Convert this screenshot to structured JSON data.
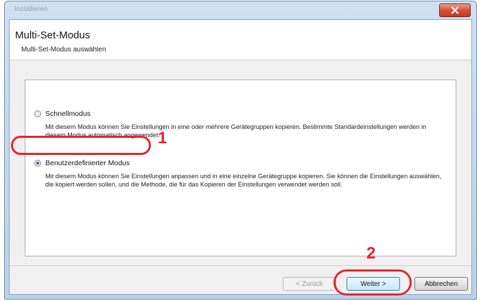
{
  "window": {
    "title": "Installieren"
  },
  "header": {
    "title": "Multi-Set-Modus",
    "subtitle": "Multi-Set-Modus auswählen"
  },
  "options": [
    {
      "label": "Schnellmodus",
      "checked": false,
      "description": "Mit diesem Modus können Sie Einstellungen in eine oder mehrere Gerätegruppen kopieren. Bestimmte Standardeinstellungen werden in diesem Modus automatisch angewendet."
    },
    {
      "label": "Benutzerdefinierter Modus",
      "checked": true,
      "description": "Mit diesem Modus können Sie Einstellungen anpassen und in eine einzelne Gerätegruppe kopieren. Sie können die Einstellungen auswählen, die kopiert werden sollen, und die Methode, die für das Kopieren der Einstellungen verwendet werden soll."
    }
  ],
  "buttons": {
    "back": "< Zurück",
    "next": "Weiter >",
    "cancel": "Abbrechen"
  },
  "annotations": [
    "1",
    "2"
  ],
  "colors": {
    "annotation": "#e8212a",
    "close_button": "#c23a22",
    "window_frame": "#b9d1ea"
  }
}
